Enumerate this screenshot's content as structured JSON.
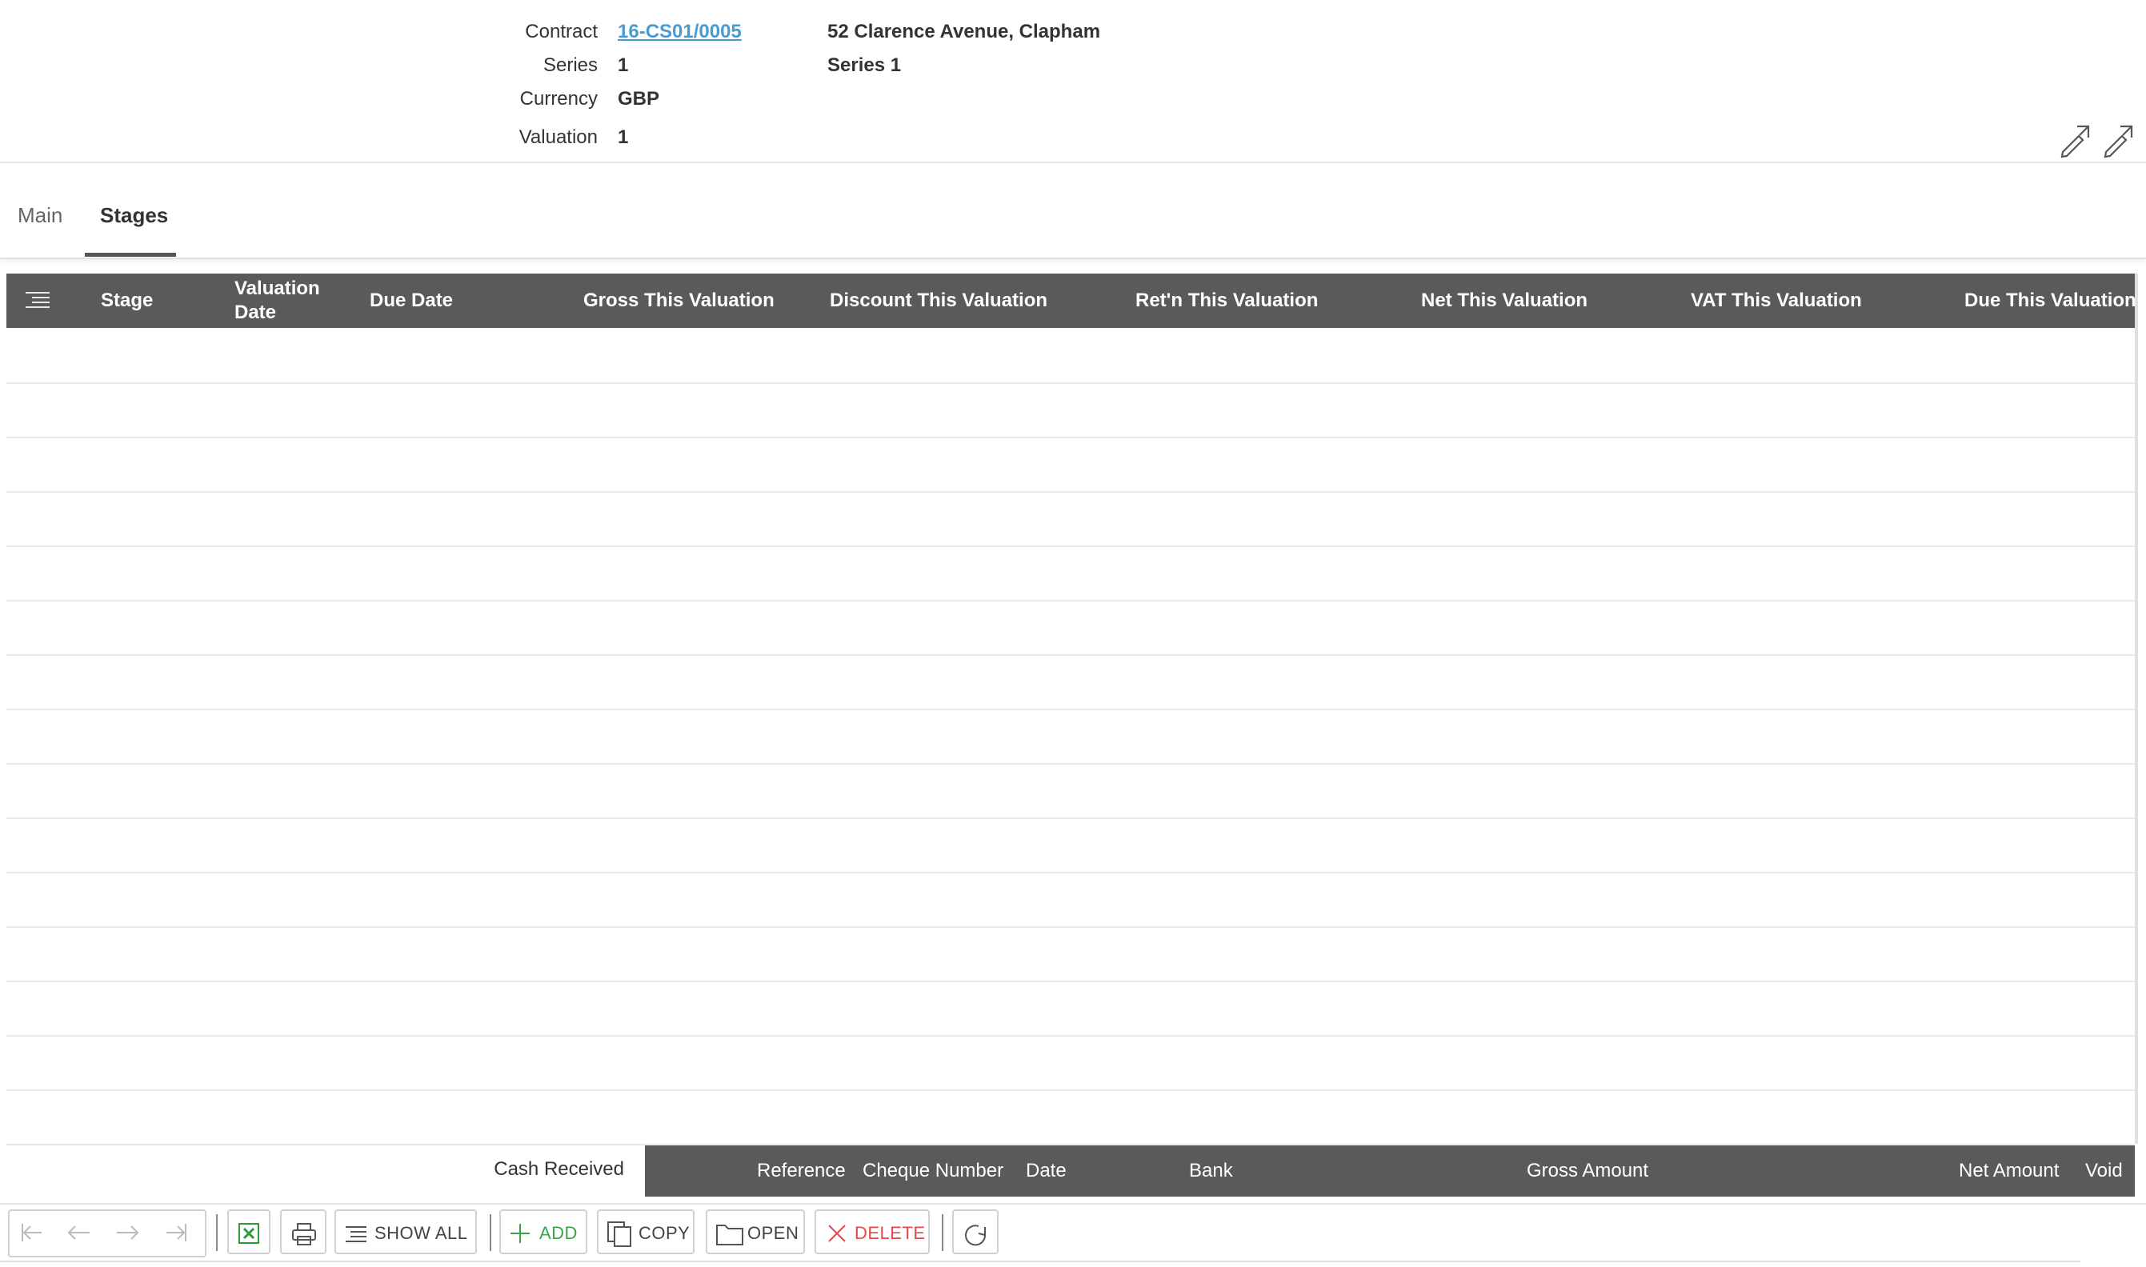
{
  "header": {
    "contract_label": "Contract",
    "contract_value": "16-CS01/0005",
    "contract_desc": "52 Clarence Avenue, Clapham",
    "series_label": "Series",
    "series_value": "1",
    "series_desc": "Series 1",
    "currency_label": "Currency",
    "currency_value": "GBP",
    "valuation_label": "Valuation",
    "valuation_value": "1"
  },
  "tabs": [
    {
      "label": "Main",
      "active": false
    },
    {
      "label": "Stages",
      "active": true
    }
  ],
  "stages_grid": {
    "columns": [
      "Stage",
      "Valuation Date",
      "Due Date",
      "Gross This Valuation",
      "Discount This Valuation",
      "Ret'n This Valuation",
      "Net This Valuation",
      "VAT This Valuation",
      "Due This Valuation"
    ],
    "rows": []
  },
  "cash_received": {
    "label": "Cash Received",
    "columns": [
      "Reference",
      "Cheque Number",
      "Date",
      "Bank",
      "Gross Amount",
      "Net Amount",
      "Void"
    ]
  },
  "toolbar": {
    "show_all": "SHOW ALL",
    "add": "ADD",
    "copy": "COPY",
    "open": "OPEN",
    "delete": "DELETE"
  },
  "colors": {
    "header_bg": "#5a5a5a",
    "link": "#4a9bd0",
    "add_green": "#3aa64a",
    "delete_red": "#e04a4a",
    "excel_green": "#2e9a3c"
  }
}
